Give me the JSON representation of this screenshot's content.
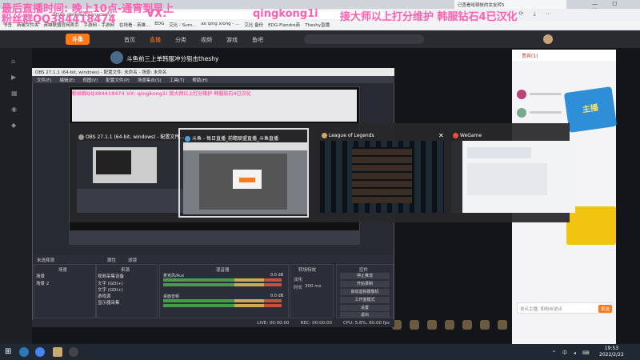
{
  "overlay": {
    "line1": "最后直播时间: 晚上10点-通宵到早上",
    "line2": "粉丝群QQ384418474",
    "vx_label": "VX:",
    "vx_id": "qingkong1i",
    "service": "接大师以上打分维护 韩服钻石4已汉化"
  },
  "browser": {
    "tab_right": "已查看哈顿帐的女友转5",
    "url": "https://www.douyu.com/...",
    "bookmarks": [
      "书签",
      "新建文件夹",
      "英雄联盟官网首页",
      "手游网 - 手游网",
      "在线看 - 英雄...",
      "EDG",
      "艾比 - Sum...",
      "ao qing xiong - ...",
      "艾比 备份",
      "EDG-Flandre英",
      "Theshy直播"
    ]
  },
  "site": {
    "logo": "斗鱼",
    "menu": [
      "首页",
      "直播",
      "分类",
      "视频",
      "游戏",
      "鱼吧"
    ],
    "menu_active": 1,
    "stream_title": "斗鱼前三上单韩服冲分狙击theshy",
    "panel_head": "贵宾(1)",
    "banner": "主播",
    "chat_placeholder": "说点主播, 和粉丝说点",
    "chat_send": "发送"
  },
  "obs": {
    "title": "OBS 27.1.1 (64-bit, windows) - 配置文件: 未命名 - 场景: 未命名",
    "menu": [
      "文件(F)",
      "编辑(E)",
      "视图(V)",
      "配置文件(P)",
      "场景集合(S)",
      "工具(T)",
      "帮助(H)"
    ],
    "preview_overlay": "粉丝群QQ384418474   VX: qingkong1i   接大师以上打分维护 韩服钻石4已汉化",
    "tabs": {
      "no_source": "未选择源",
      "properties": "属性",
      "filters": "滤镜"
    },
    "panels": {
      "scenes": "场景",
      "sources": "来源",
      "mixer": "混音器",
      "transitions": "转场特效",
      "controls": "控件"
    },
    "scenes": [
      "场景",
      "场景 2"
    ],
    "sources": [
      "视频采集设备",
      "文字 (GDI+)",
      "文字 (GDI+)",
      "游戏源",
      "显示器采集"
    ],
    "mixer": [
      {
        "name": "桌面音频",
        "db": "0.0 dB"
      },
      {
        "name": "麦克风/Aux",
        "db": "0.0 dB"
      }
    ],
    "transition": {
      "type": "淡化",
      "duration_label": "时长",
      "duration": "300 ms"
    },
    "buttons": [
      "停止推流",
      "开始录制",
      "启动虚拟摄像机",
      "工作室模式",
      "设置",
      "退出"
    ],
    "status": {
      "live": "LIVE: 00:00:00",
      "rec": "REC: 00:00:00",
      "cpu": "CPU: 5.8%, 60.00 fps"
    }
  },
  "switcher": {
    "windows": [
      {
        "title": "OBS 27.1.1 (64-bit, windows) - 配置文件..."
      },
      {
        "title": "斗鱼 - 每日直播_前瞻联盟直播_斗鱼直播"
      },
      {
        "title": "League of Legends"
      },
      {
        "title": "WeGame"
      }
    ],
    "close": "✕"
  },
  "taskbar": {
    "time": "19:53",
    "date": "2022/2/22",
    "tray": "^ 中 ◂ ⌨"
  },
  "colors": {
    "overlay": "#ff5fb0",
    "douyu_orange": "#ff7a1a",
    "obs_bg": "#272a33"
  }
}
